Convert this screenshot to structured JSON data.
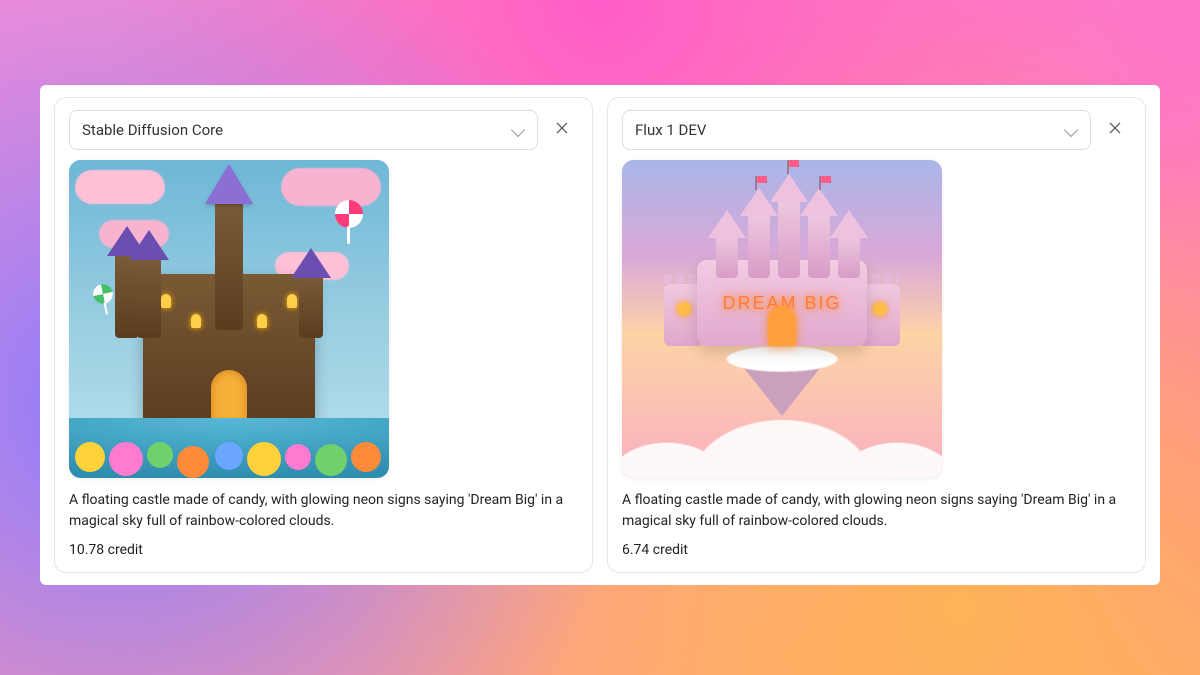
{
  "panes": [
    {
      "model_label": "Stable Diffusion Core",
      "prompt": "A floating castle made of candy, with glowing neon signs saying 'Dream Big' in a magical sky full of rainbow-colored clouds.",
      "credit_text": "10.78 credit",
      "image_alt": "candy-castle-with-lollipops-and-pink-clouds"
    },
    {
      "model_label": "Flux 1 DEV",
      "prompt": "A floating castle made of candy, with glowing neon signs saying 'Dream Big' in a magical sky full of rainbow-colored clouds.",
      "credit_text": "6.74 credit",
      "image_alt": "pink-floating-castle-dream-big-sign",
      "sign_text": "DREAM BIG"
    }
  ]
}
